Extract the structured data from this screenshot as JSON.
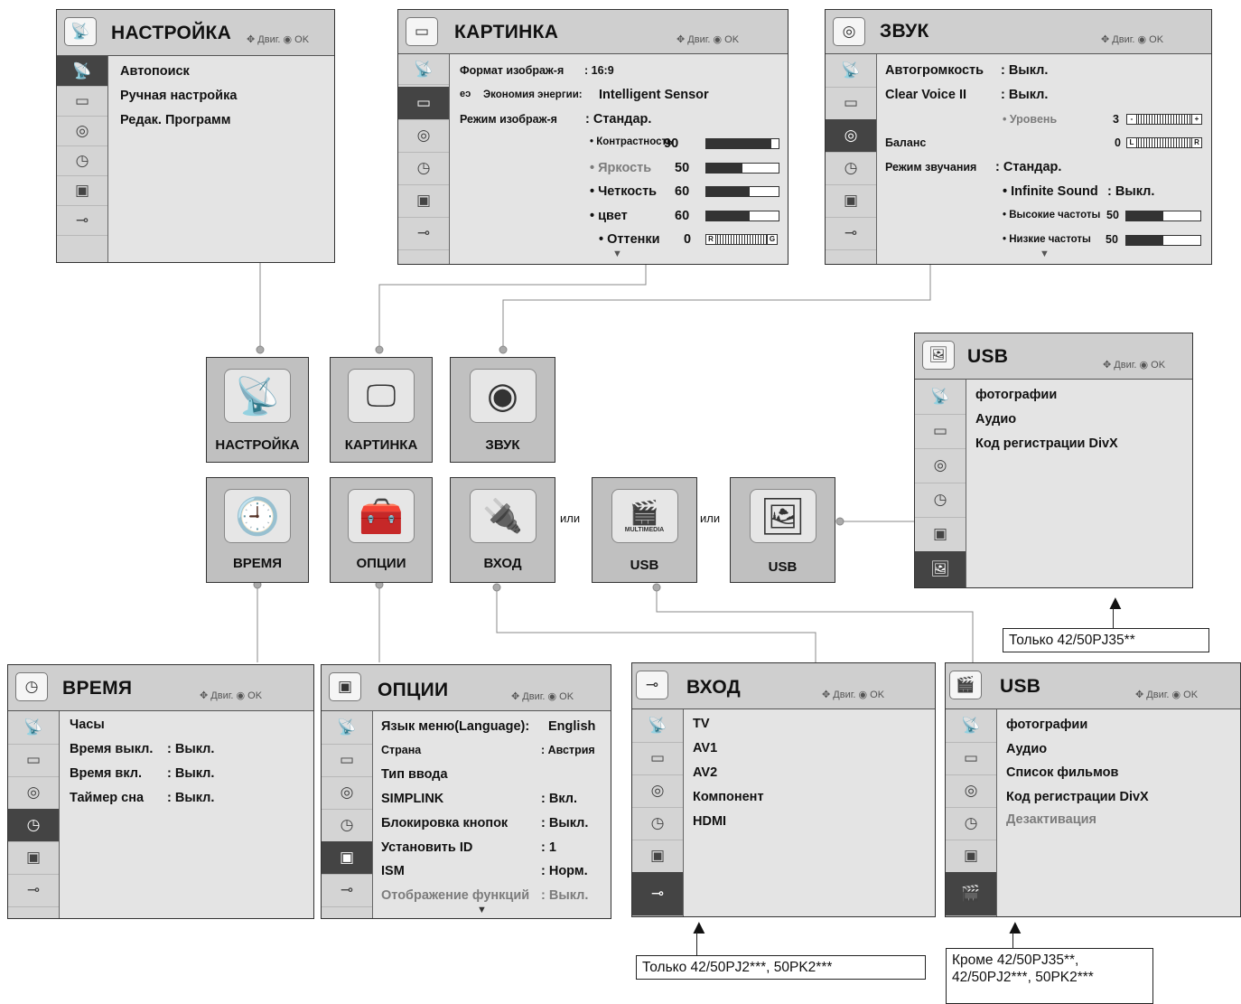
{
  "nav_hint": "Двиг.",
  "ok_hint": "OK",
  "ili": "или",
  "setup_panel": {
    "title": "НАСТРОЙКА",
    "items": [
      "Автопоиск",
      "Ручная настройка",
      "Редак. Программ"
    ]
  },
  "picture_panel": {
    "title": "КАРТИНКА",
    "format_label": "Формат изображ-я",
    "format_value": ": 16:9",
    "energy_label": "Экономия энергии:",
    "energy_value": "Intelligent Sensor",
    "mode_label": "Режим изображ-я",
    "mode_value": ": Стандар.",
    "levels": [
      {
        "label": "• Контрастность",
        "value": "90",
        "level": 90,
        "dim": false
      },
      {
        "label": "• Яркость",
        "value": "50",
        "level": 50,
        "dim": true
      },
      {
        "label": "• Четкость",
        "value": "60",
        "level": 60,
        "dim": false
      },
      {
        "label": "• цвет",
        "value": "60",
        "level": 60,
        "dim": false
      }
    ],
    "tint_label": "• Оттенки",
    "tint_value": "0",
    "tint_left": "R",
    "tint_right": "G"
  },
  "sound_panel": {
    "title": "ЗВУК",
    "avl_label": "Автогромкость",
    "avl_value": ": Выкл.",
    "cv_label": "Clear Voice II",
    "cv_value": ": Выкл.",
    "level_label": "• Уровень",
    "level_value": "3",
    "level_left": "-",
    "level_right": "+",
    "balance_label": "Баланс",
    "balance_value": "0",
    "balance_left": "L",
    "balance_right": "R",
    "mode_label": "Режим звучания",
    "mode_value": ": Стандар.",
    "infinite_label": "• Infinite Sound",
    "infinite_value": ": Выкл.",
    "treble_label": "• Высокие частоты",
    "treble_value": "50",
    "treble_level": 50,
    "bass_label": "• Низкие частоты",
    "bass_value": "50",
    "bass_level": 50
  },
  "usb_top_panel": {
    "title": "USB",
    "items": [
      "фотографии",
      "Аудио",
      "Код регистрации DivX"
    ]
  },
  "tiles": {
    "setup": "НАСТРОЙКА",
    "picture": "КАРТИНКА",
    "sound": "ЗВУК",
    "time": "ВРЕМЯ",
    "option": "ОПЦИИ",
    "input": "ВХОД",
    "usb_multimedia": "USB",
    "usb_photo": "USB",
    "multimedia_badge": "MULTIMEDIA"
  },
  "time_panel": {
    "title": "ВРЕМЯ",
    "rows": [
      {
        "label": "Часы",
        "value": ""
      },
      {
        "label": "Время выкл.",
        "value": ": Выкл."
      },
      {
        "label": "Время вкл.",
        "value": ": Выкл."
      },
      {
        "label": "Таймер сна",
        "value": ": Выкл."
      }
    ]
  },
  "option_panel": {
    "title": "ОПЦИИ",
    "rows": [
      {
        "label": "Язык меню(Language):",
        "value": "English",
        "small": false,
        "dim": false
      },
      {
        "label": "Страна",
        "value": ": Австрия",
        "small": true,
        "dim": false
      },
      {
        "label": "Тип ввода",
        "value": "",
        "small": false,
        "dim": false
      },
      {
        "label": "SIMPLINK",
        "value": ": Вкл.",
        "small": false,
        "dim": false
      },
      {
        "label": "Блокировка кнопок",
        "value": ": Выкл.",
        "small": false,
        "dim": false
      },
      {
        "label": "Установить ID",
        "value": ": 1",
        "small": false,
        "dim": false
      },
      {
        "label": "ISM",
        "value": ": Норм.",
        "small": false,
        "dim": false
      },
      {
        "label": "Отображение функций",
        "value": ": Выкл.",
        "small": false,
        "dim": true
      }
    ]
  },
  "input_panel": {
    "title": "ВХОД",
    "items": [
      "TV",
      "AV1",
      "AV2",
      "Компонент",
      "HDMI"
    ]
  },
  "usb_bottom_panel": {
    "title": "USB",
    "items": [
      "фотографии",
      "Аудио",
      "Список фильмов",
      "Код регистрации DivX"
    ],
    "dim_item": "Дезактивация"
  },
  "notes": {
    "top_right": "Только 42/50PJ35**",
    "bottom_mid": "Только 42/50PJ2***, 50PK2***",
    "bottom_right_1": "Кроме 42/50PJ35**,",
    "bottom_right_2": "42/50PJ2***, 50PK2***"
  },
  "icons": [
    "satellite-icon",
    "tv-icon",
    "speaker-icon",
    "clock-icon",
    "toolbox-icon",
    "plug-icon",
    "usb-photo-icon",
    "usb-multimedia-icon"
  ],
  "colors": {
    "selected": "#444444",
    "header": "#cfcfcf",
    "panel": "#e4e4e4",
    "tile": "#c0c0c0",
    "dim_text": "#7c7c7c"
  }
}
